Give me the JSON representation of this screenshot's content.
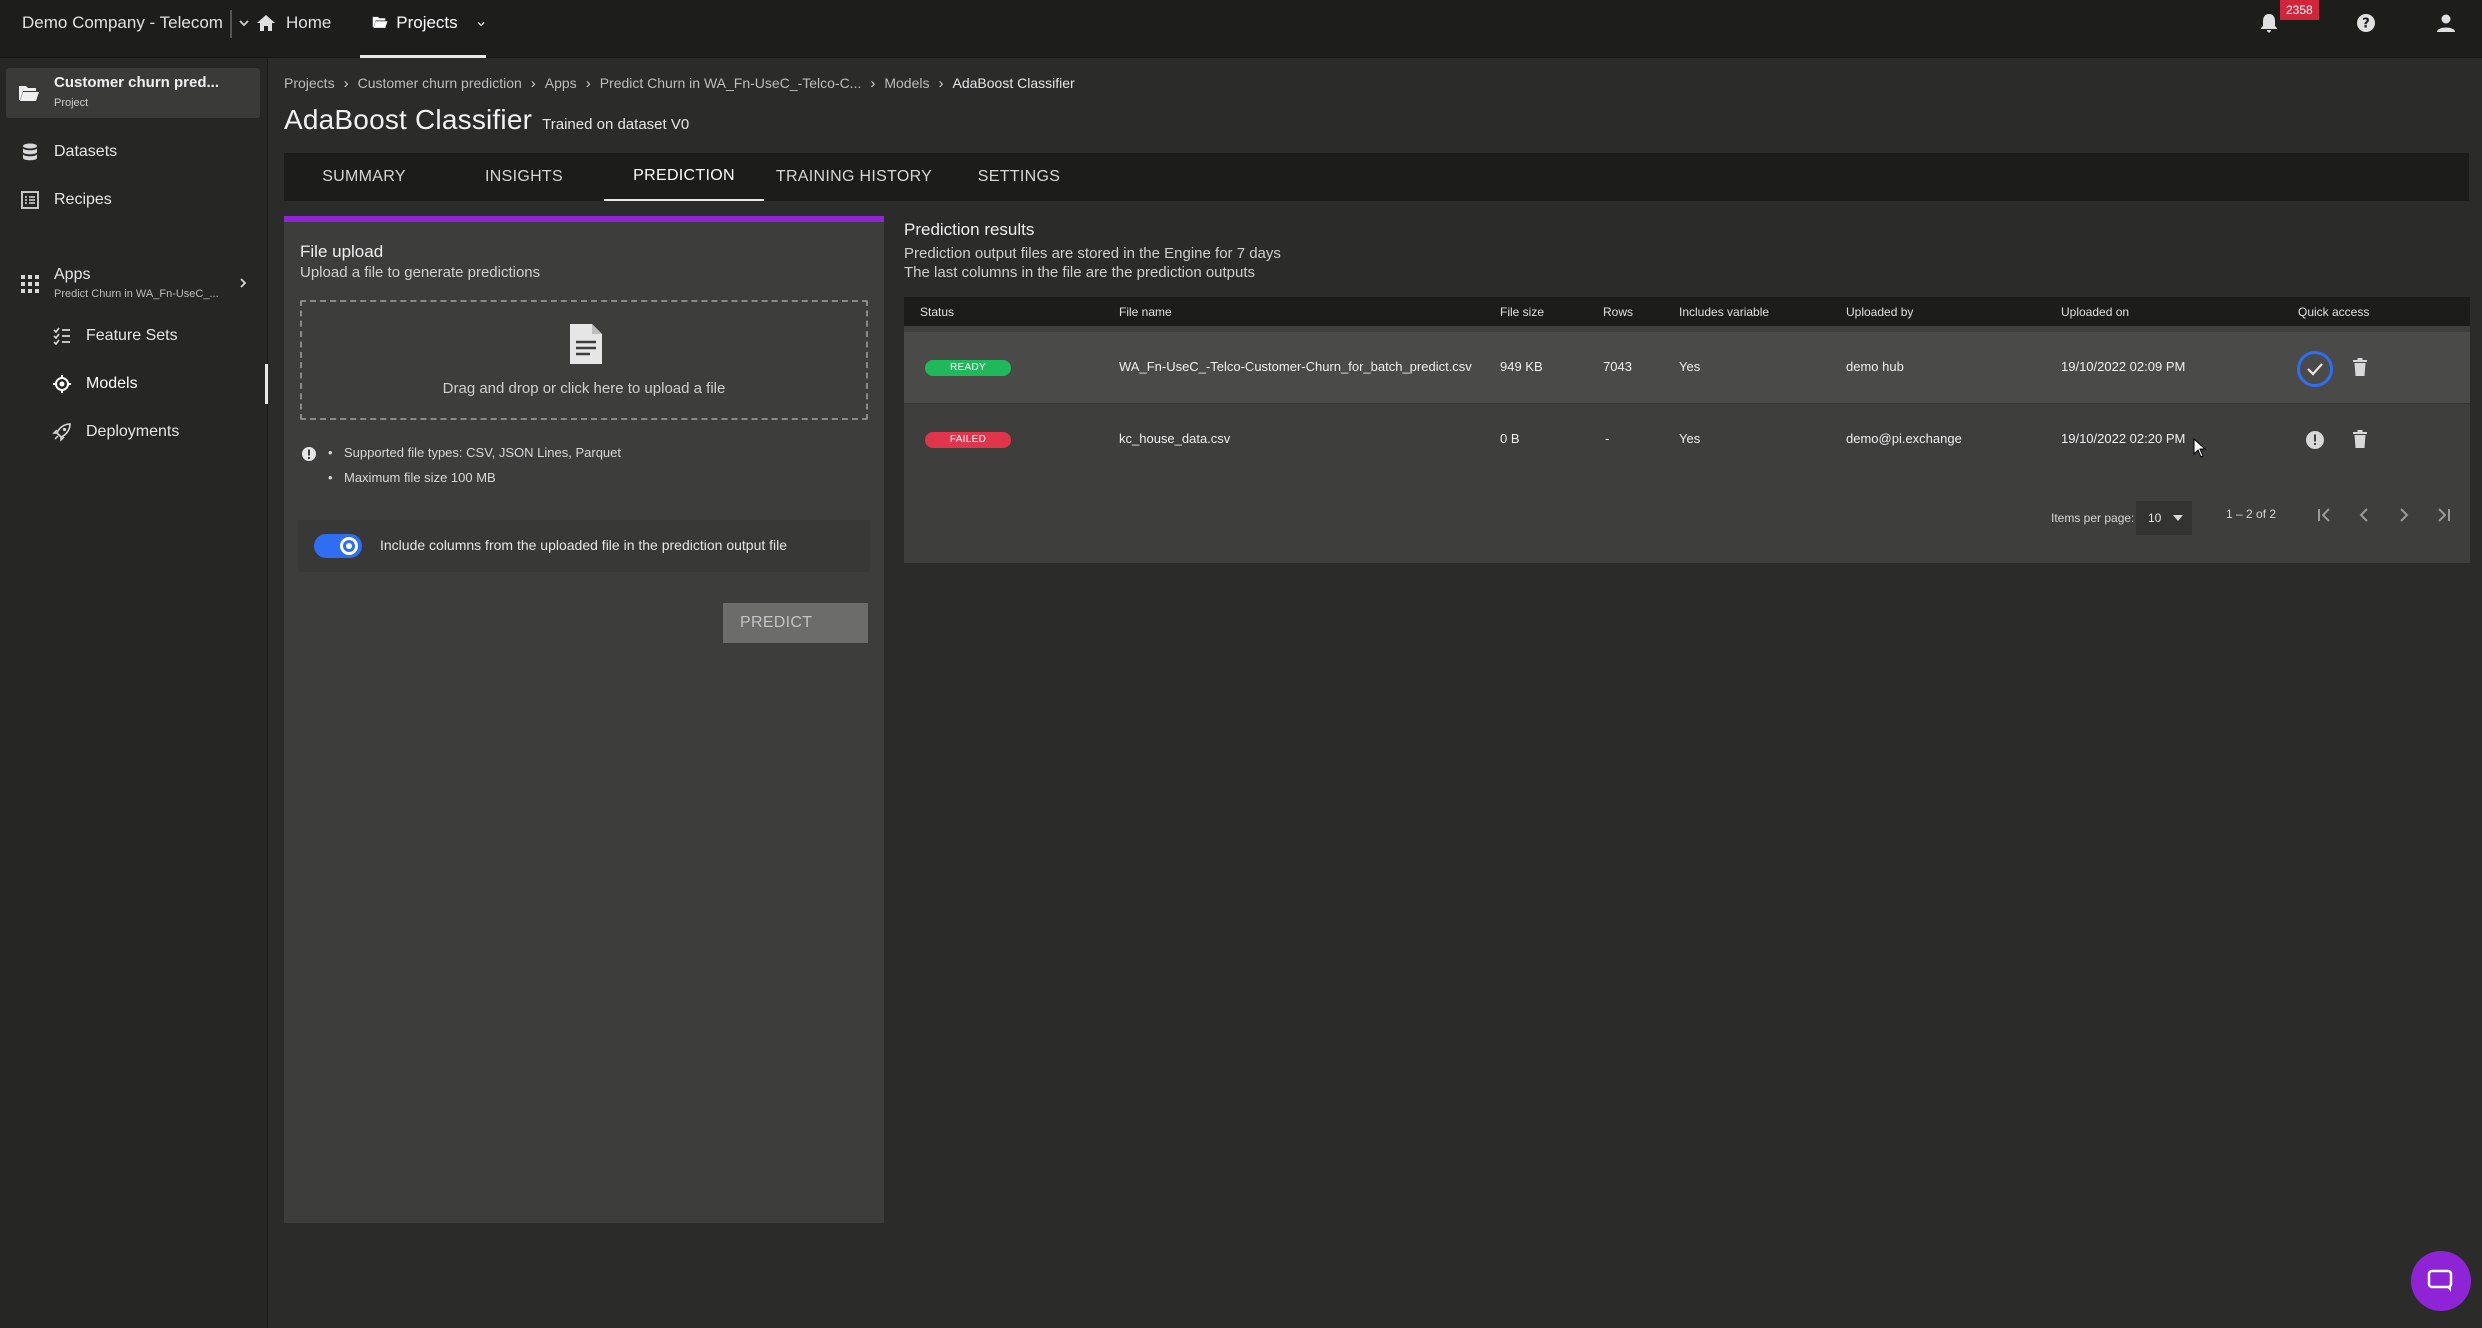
{
  "topbar": {
    "company": "Demo Company - Telecom",
    "home_label": "Home",
    "projects_label": "Projects",
    "notification_count": "2358"
  },
  "sidebar": {
    "project_name": "Customer churn pred...",
    "project_type": "Project",
    "items": [
      {
        "label": "Datasets",
        "icon": "database-icon"
      },
      {
        "label": "Recipes",
        "icon": "list-icon"
      }
    ],
    "apps_label": "Apps",
    "apps_sublabel": "Predict Churn in WA_Fn-UseC_...",
    "sub_items": [
      {
        "label": "Feature Sets",
        "icon": "checklist-icon"
      },
      {
        "label": "Models",
        "icon": "model-icon",
        "active": true
      },
      {
        "label": "Deployments",
        "icon": "rocket-icon"
      }
    ]
  },
  "breadcrumb": [
    "Projects",
    "Customer churn prediction",
    "Apps",
    "Predict Churn in WA_Fn-UseC_-Telco-C...",
    "Models",
    "AdaBoost Classifier"
  ],
  "page": {
    "title": "AdaBoost Classifier",
    "subtitle": "Trained on dataset V0"
  },
  "tabs": [
    {
      "label": "SUMMARY"
    },
    {
      "label": "INSIGHTS"
    },
    {
      "label": "PREDICTION",
      "active": true
    },
    {
      "label": "TRAINING HISTORY"
    },
    {
      "label": "SETTINGS"
    }
  ],
  "upload": {
    "title": "File upload",
    "subtitle": "Upload a file to generate predictions",
    "dropzone_text": "Drag and drop or click here to upload a file",
    "requirements": [
      "Supported file types: CSV, JSON Lines, Parquet",
      "Maximum file size 100 MB"
    ],
    "toggle_label": "Include columns from the uploaded file in the prediction output file",
    "toggle_on": true,
    "predict_label": "PREDICT"
  },
  "results": {
    "title": "Prediction results",
    "line1": "Prediction output files are stored in the Engine for 7 days",
    "line2": "The last columns in the file are the prediction outputs",
    "columns": [
      "Status",
      "File name",
      "File size",
      "Rows",
      "Includes variable",
      "Uploaded by",
      "Uploaded on",
      "Quick access"
    ],
    "rows": [
      {
        "status": "READY",
        "file_name": "WA_Fn-UseC_-Telco-Customer-Churn_for_batch_predict.csv",
        "file_size": "949 KB",
        "rows": "7043",
        "includes_variable": "Yes",
        "uploaded_by": "demo hub",
        "uploaded_on": "19/10/2022 02:09 PM"
      },
      {
        "status": "FAILED",
        "file_name": "kc_house_data.csv",
        "file_size": "0 B",
        "rows": "-",
        "includes_variable": "Yes",
        "uploaded_by": "demo@pi.exchange",
        "uploaded_on": "19/10/2022 02:20 PM"
      }
    ],
    "items_per_page_label": "Items per page:",
    "items_per_page": "10",
    "range": "1 – 2 of 2"
  },
  "colors": {
    "accent_purple": "#8e24d6",
    "toggle_blue": "#2f6ef2",
    "ready_green": "#20b85a",
    "failed_red": "#e0354a",
    "badge_red": "#d0253a"
  }
}
